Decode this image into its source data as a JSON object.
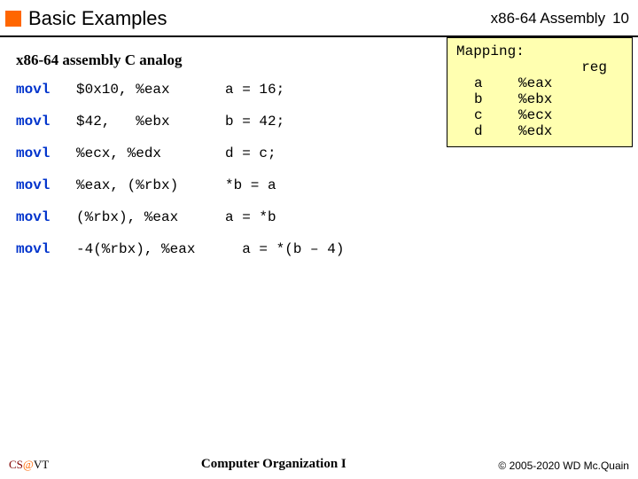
{
  "header": {
    "title": "Basic Examples",
    "subject": "x86-64 Assembly",
    "slide_number": "10"
  },
  "section_heading": "x86-64 assembly C analog",
  "rows": [
    {
      "mnemonic": "movl",
      "operands": "$0x10, %eax",
      "c": "a = 16;"
    },
    {
      "mnemonic": "movl",
      "operands": "$42,   %ebx",
      "c": "b = 42;"
    },
    {
      "mnemonic": "movl",
      "operands": "%ecx, %edx",
      "c": "d = c;"
    },
    {
      "mnemonic": "movl",
      "operands": "%eax, (%rbx)",
      "c": "*b = a"
    },
    {
      "mnemonic": "movl",
      "operands": "(%rbx), %eax",
      "c": "a = *b"
    },
    {
      "mnemonic": "movl",
      "operands": "-4(%rbx), %eax",
      "c": "  a = *(b – 4)"
    }
  ],
  "mapping": {
    "title": "Mapping:",
    "reg_head": "reg",
    "entries": [
      {
        "var": "a",
        "reg": "%eax"
      },
      {
        "var": "b",
        "reg": "%ebx"
      },
      {
        "var": "c",
        "reg": "%ecx"
      },
      {
        "var": "d",
        "reg": "%edx"
      }
    ]
  },
  "footer": {
    "left_cs": "CS",
    "left_at": "@",
    "left_vt": "VT",
    "center": "Computer Organization I",
    "right": "© 2005-2020  WD Mc.Quain"
  }
}
